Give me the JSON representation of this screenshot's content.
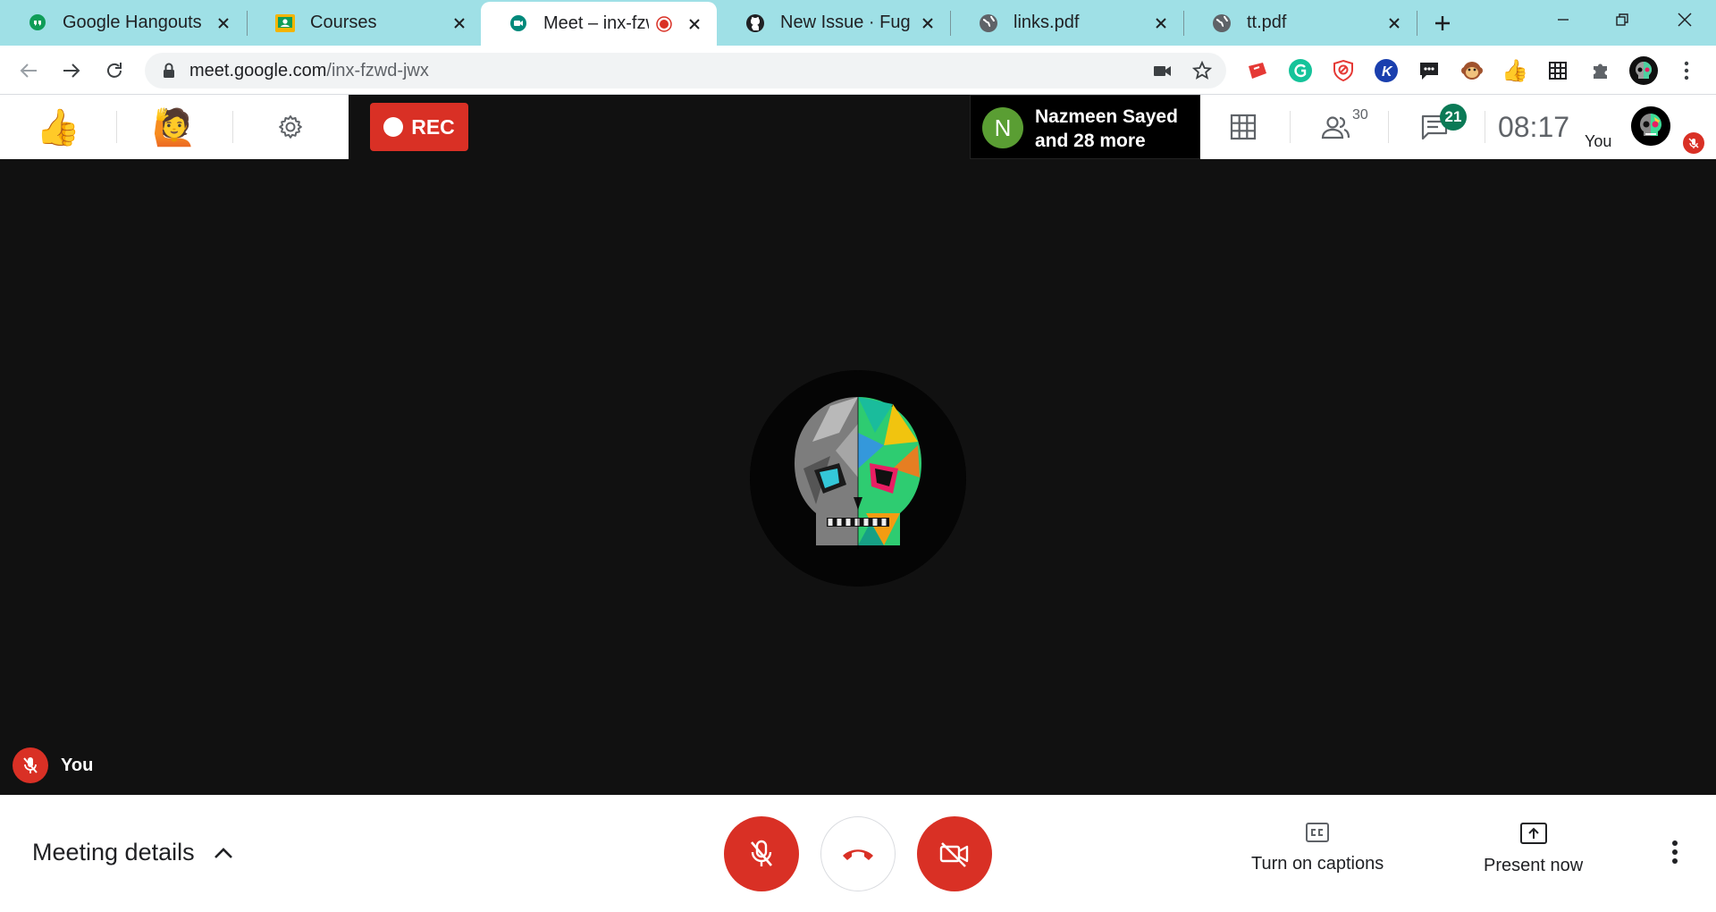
{
  "browser": {
    "tabs": [
      {
        "title": "Google Hangouts",
        "icon": "hangouts-icon"
      },
      {
        "title": "Courses",
        "icon": "classroom-icon"
      },
      {
        "title": "Meet – inx-fzwd-",
        "icon": "meet-icon",
        "active": true,
        "recording": true
      },
      {
        "title": "New Issue · Fugiman/",
        "icon": "github-icon"
      },
      {
        "title": "links.pdf",
        "icon": "globe-icon"
      },
      {
        "title": "tt.pdf",
        "icon": "globe-icon"
      }
    ],
    "url_host": "meet.google.com",
    "url_path": "/inx-fzwd-jwx"
  },
  "meet": {
    "rec_label": "REC",
    "join_avatar_letter": "N",
    "join_line1": "Nazmeen Sayed",
    "join_line2": "and 28 more",
    "participants_count": "30",
    "chat_count": "21",
    "time": "08:17",
    "self_label": "You",
    "stage_label": "You",
    "meeting_details": "Meeting details",
    "captions_label": "Turn on captions",
    "present_label": "Present now"
  },
  "colors": {
    "tabstrip": "#9fe0e6",
    "danger": "#d93025",
    "chat_badge": "#0b7a56",
    "avatar_green": "#5a9e33"
  }
}
